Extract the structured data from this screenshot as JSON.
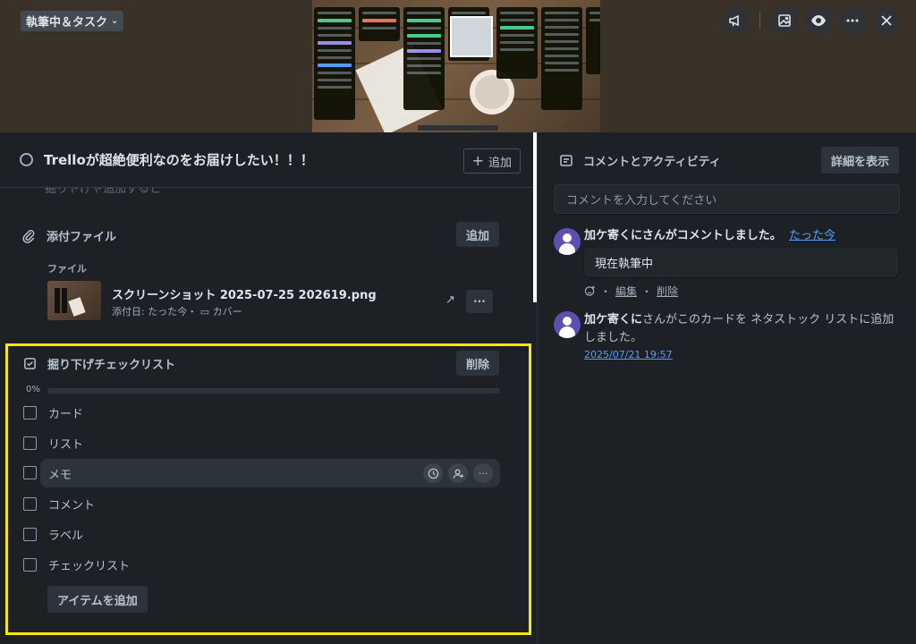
{
  "header": {
    "board_name": "執筆中＆タスク",
    "icons": [
      "megaphone-icon",
      "image-icon",
      "eye-icon",
      "more-icon",
      "close-icon"
    ]
  },
  "card": {
    "title": "Trelloが超絶便利なのをお届けしたい！！！",
    "add_label": "追加",
    "cutoff_text": "掘りトげや追加すると"
  },
  "attachments": {
    "heading": "添付ファイル",
    "add_label": "追加",
    "file_section_label": "ファイル",
    "file_name": "スクリーンショット 2025-07-25 202619.png",
    "file_meta_prefix": "添付日: たった今・",
    "file_meta_cover": "カバー"
  },
  "checklist": {
    "title": "掘り下げチェックリスト",
    "delete_label": "削除",
    "progress_label": "0%",
    "progress": 0,
    "items": [
      "カード",
      "リスト",
      "メモ",
      "コメント",
      "ラベル",
      "チェックリスト"
    ],
    "add_item_label": "アイテムを追加"
  },
  "activity": {
    "heading": "コメントとアクティビティ",
    "detail_label": "詳細を表示",
    "comment_placeholder": "コメントを入力してください",
    "entry1": {
      "user": "加ケ寄くに",
      "action": "さんがコメントしました。",
      "time": "たった今",
      "comment": "現在執筆中",
      "edit_label": "編集",
      "delete_label": "削除"
    },
    "entry2": {
      "user": "加ケ寄くに",
      "action_line1": "さんがこのカードを ネタストック リストに追加",
      "action_line2": "しました。",
      "time": "2025/07/21 19:57"
    }
  },
  "colors": {
    "highlight": "#f5e80e",
    "link": "#579dff",
    "avatar": "#5e4db2"
  }
}
